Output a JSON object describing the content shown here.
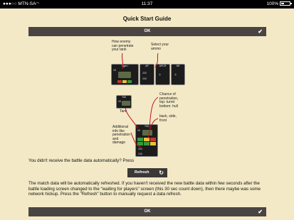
{
  "status_bar": {
    "carrier": "●●●○○ MTN-SA",
    "wifi_icon": "wifi-icon",
    "time": "11:37",
    "battery": "100%"
  },
  "page": {
    "title": "Quick Start Guide"
  },
  "ok_button_top": {
    "label": "OK",
    "icon": "check-icon"
  },
  "ok_button_bottom": {
    "label": "OK",
    "icon": "check-icon"
  },
  "diagram": {
    "captions": {
      "penetrate": "How enemy\ncan penetrate\nyour tank",
      "ammo": "Select your\nammo",
      "chance": "Chance of\npenetration,\ntop: turret\nbottom: hull",
      "sides": "back, side,\nfront",
      "select_tank": "Select\nTank",
      "additional": "Additional\ninfo like\npenetration\nand\ndamage"
    },
    "panel_top": {
      "tier": "VII",
      "name": "Tiger I",
      "ammo_ap": "AP",
      "ammo_apcr": "APCR",
      "ammo_he": "HE",
      "vals": [
        "203",
        "240"
      ]
    },
    "panel_mid": {
      "tier": "VII",
      "name": "T32"
    },
    "panel_bottom": {
      "tier": "VII",
      "name": "T32",
      "vals": [
        "200",
        "240"
      ]
    }
  },
  "text": {
    "no_data": "You didn't receive the battle data automatically? Press",
    "auto_refresh": "The match data will be automatically refreshed. If you haven't received the new battle data within few seconds after the battle loading screen changed to the \"waiting for players\" screen (this 30 sec count down), then there maybe was some network hickup. Press the \"Refresh\" button to manually request a data refresh."
  },
  "refresh_button": {
    "label": "Refresh",
    "icon": "refresh-icon"
  }
}
